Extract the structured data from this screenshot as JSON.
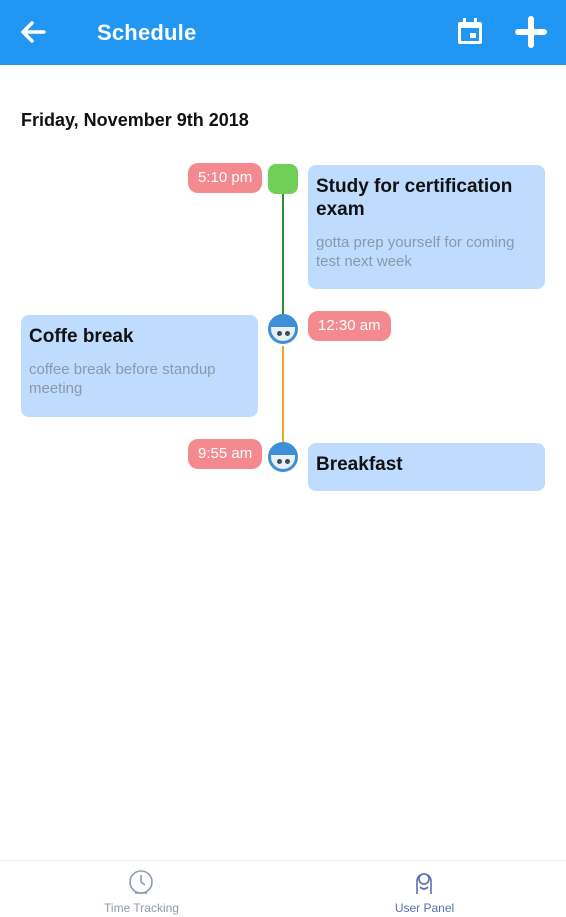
{
  "header": {
    "title": "Schedule",
    "background_color": "#2196f3",
    "back_icon": "arrow-left-icon",
    "calendar_icon": "calendar-icon",
    "add_icon": "plus-icon"
  },
  "date_heading": "Friday, November 9th 2018",
  "timeline": [
    {
      "time": "5:10 pm",
      "title": "Study for certification exam",
      "description": "gotta prep yourself for coming test next week",
      "node_color": "#6fcf57",
      "line_color_below": "#2e8b3a"
    },
    {
      "time": "12:30 am",
      "title": "Coffe break",
      "description": "coffee break before standup meeting",
      "node_color": "#3d8fd8",
      "line_color_below": "#f0a62e"
    },
    {
      "time": "9:55 am",
      "title": "Breakfast",
      "description": "",
      "node_color": "#3d8fd8"
    }
  ],
  "bottom_nav": {
    "items": [
      {
        "label": "Time Tracking",
        "icon": "clock-icon",
        "color": "#8f9ab0"
      },
      {
        "label": "User Panel",
        "icon": "user-icon",
        "color": "#5a6fb0",
        "active": true
      }
    ]
  }
}
